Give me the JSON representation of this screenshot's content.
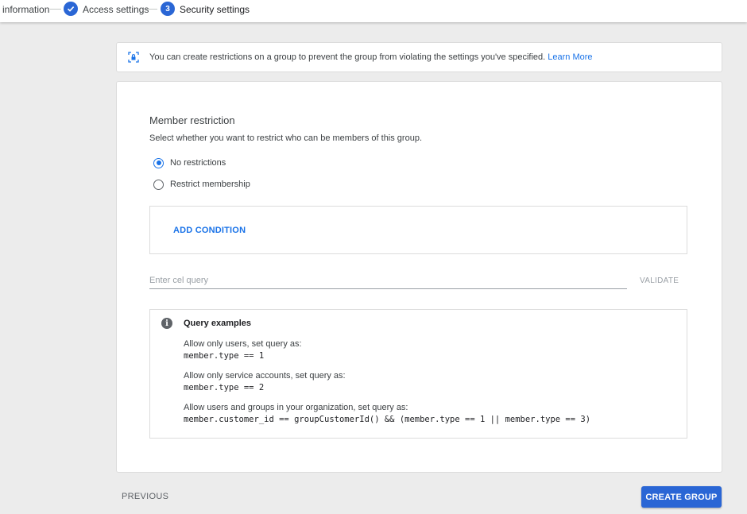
{
  "stepper": {
    "step1_label": "information",
    "step2_label": "Access settings",
    "step3_number": "3",
    "step3_label": "Security settings"
  },
  "banner": {
    "text": "You can create restrictions on a group to prevent the group from violating the settings you've specified.",
    "link": "Learn More"
  },
  "member_restriction": {
    "title": "Member restriction",
    "description": "Select whether you want to restrict who can be members of this group.",
    "options": [
      {
        "label": "No restrictions",
        "checked": true
      },
      {
        "label": "Restrict membership",
        "checked": false
      }
    ],
    "add_condition": "ADD CONDITION",
    "query_placeholder": "Enter cel query",
    "query_value": "",
    "validate": "VALIDATE"
  },
  "query_examples": {
    "title": "Query examples",
    "items": [
      {
        "desc": "Allow only users, set query as:",
        "code": "member.type == 1"
      },
      {
        "desc": "Allow only service accounts, set query as:",
        "code": "member.type == 2"
      },
      {
        "desc": "Allow users and groups in your organization, set query as:",
        "code": "member.customer_id == groupCustomerId() && (member.type == 1 || member.type == 3)"
      }
    ]
  },
  "footer": {
    "previous": "PREVIOUS",
    "create_group": "CREATE GROUP"
  },
  "colors": {
    "accent": "#1a73e8",
    "primary_button": "#2a66d5",
    "background": "#ececec"
  },
  "icons": {
    "step2": "check-icon",
    "banner": "lock-icon",
    "examples": "info-icon"
  }
}
